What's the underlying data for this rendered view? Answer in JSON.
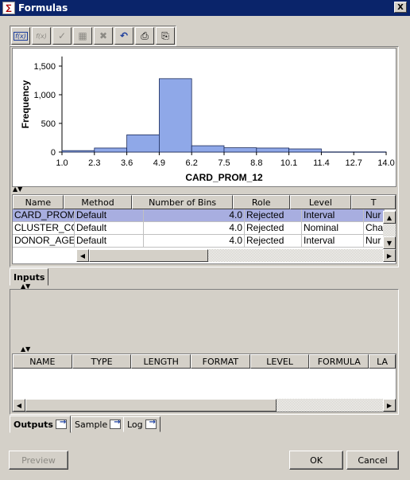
{
  "window": {
    "title": "Formulas",
    "close_glyph": "X",
    "app_icon_glyph": "∑"
  },
  "toolbar": {
    "buttons": [
      {
        "name": "create-formula",
        "glyph": "f(x)",
        "enabled": true
      },
      {
        "name": "edit-formula",
        "glyph": "f(x)",
        "enabled": false
      },
      {
        "name": "check",
        "glyph": "✓",
        "enabled": false
      },
      {
        "name": "table",
        "glyph": "▦",
        "enabled": false
      },
      {
        "name": "delete",
        "glyph": "✖",
        "enabled": false
      },
      {
        "name": "undo",
        "glyph": "↶",
        "enabled": true
      },
      {
        "name": "print",
        "glyph": "⎙",
        "enabled": true
      },
      {
        "name": "copy",
        "glyph": "⎘",
        "enabled": true
      }
    ]
  },
  "chart_data": {
    "type": "bar",
    "xlabel": "CARD_PROM_12",
    "ylabel": "Frequency",
    "x_ticks": [
      "1.0",
      "2.3",
      "3.6",
      "4.9",
      "6.2",
      "7.5",
      "8.8",
      "10.1",
      "11.4",
      "12.7",
      "14.0"
    ],
    "y_ticks": [
      "0",
      "500",
      "1,000",
      "1,500"
    ],
    "ylim": [
      0,
      1500
    ],
    "bins": [
      {
        "from": 1.0,
        "to": 2.3,
        "value": 25
      },
      {
        "from": 2.3,
        "to": 3.6,
        "value": 70
      },
      {
        "from": 3.6,
        "to": 4.9,
        "value": 300
      },
      {
        "from": 4.9,
        "to": 6.2,
        "value": 1280
      },
      {
        "from": 6.2,
        "to": 7.5,
        "value": 110
      },
      {
        "from": 7.5,
        "to": 8.8,
        "value": 75
      },
      {
        "from": 8.8,
        "to": 10.1,
        "value": 70
      },
      {
        "from": 10.1,
        "to": 11.4,
        "value": 55
      },
      {
        "from": 11.4,
        "to": 12.7,
        "value": 3
      },
      {
        "from": 12.7,
        "to": 14.0,
        "value": 3
      }
    ],
    "bar_color": "#8fa8e8",
    "bar_edge_color": "#1a2a5a"
  },
  "inputs_table": {
    "columns": [
      "Name",
      "Method",
      "Number of Bins",
      "Role",
      "Level",
      "T"
    ],
    "rows": [
      {
        "name": "CARD_PROM",
        "method": "Default",
        "bins": "4.0",
        "role": "Rejected",
        "level": "Interval",
        "type": "Nur",
        "selected": true
      },
      {
        "name": "CLUSTER_CC",
        "method": "Default",
        "bins": "4.0",
        "role": "Rejected",
        "level": "Nominal",
        "type": "Cha",
        "selected": false
      },
      {
        "name": "DONOR_AGE",
        "method": "Default",
        "bins": "4.0",
        "role": "Rejected",
        "level": "Interval",
        "type": "Nur",
        "selected": false
      }
    ]
  },
  "tabs_top": [
    {
      "label": "Inputs",
      "active": true
    }
  ],
  "outputs_table": {
    "columns": [
      "NAME",
      "TYPE",
      "LENGTH",
      "FORMAT",
      "LEVEL",
      "FORMULA",
      "LA"
    ],
    "rows": []
  },
  "tabs_bottom": [
    {
      "label": "Outputs",
      "active": true
    },
    {
      "label": "Sample",
      "active": false
    },
    {
      "label": "Log",
      "active": false
    }
  ],
  "buttons": {
    "preview": "Preview",
    "ok": "OK",
    "cancel": "Cancel"
  }
}
